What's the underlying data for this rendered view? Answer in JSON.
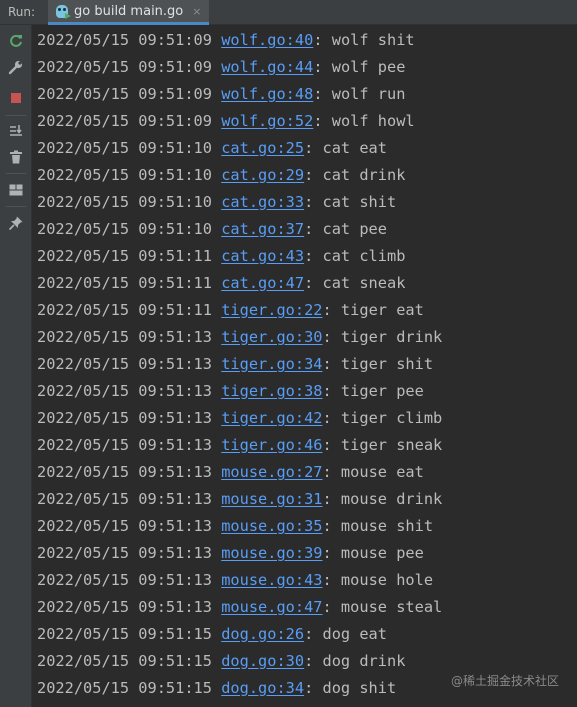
{
  "window": {
    "run_label": "Run:",
    "tab_title": "go build main.go",
    "tab_close": "×",
    "tab_icon": "go-gopher-run-icon"
  },
  "toolbar": {
    "buttons": [
      {
        "icon": "rerun-icon",
        "color": "#59a869"
      },
      {
        "icon": "wrench-icon",
        "color": "#afb1b3"
      },
      {
        "icon": "stop-icon",
        "color": "#c75450"
      },
      {
        "icon": "scroll-to-end-icon",
        "color": "#afb1b3"
      },
      {
        "icon": "trash-icon",
        "color": "#afb1b3"
      },
      {
        "icon": "layout-icon",
        "color": "#afb1b3"
      },
      {
        "icon": "pin-icon",
        "color": "#afb1b3"
      }
    ]
  },
  "console": {
    "lines": [
      {
        "timestamp": "2022/05/15 09:51:09",
        "link": "wolf.go:40",
        "message": ": wolf shit"
      },
      {
        "timestamp": "2022/05/15 09:51:09",
        "link": "wolf.go:44",
        "message": ": wolf pee"
      },
      {
        "timestamp": "2022/05/15 09:51:09",
        "link": "wolf.go:48",
        "message": ": wolf run"
      },
      {
        "timestamp": "2022/05/15 09:51:09",
        "link": "wolf.go:52",
        "message": ": wolf howl"
      },
      {
        "timestamp": "2022/05/15 09:51:10",
        "link": "cat.go:25",
        "message": ": cat eat"
      },
      {
        "timestamp": "2022/05/15 09:51:10",
        "link": "cat.go:29",
        "message": ": cat drink"
      },
      {
        "timestamp": "2022/05/15 09:51:10",
        "link": "cat.go:33",
        "message": ": cat shit"
      },
      {
        "timestamp": "2022/05/15 09:51:10",
        "link": "cat.go:37",
        "message": ": cat pee"
      },
      {
        "timestamp": "2022/05/15 09:51:11",
        "link": "cat.go:43",
        "message": ": cat climb"
      },
      {
        "timestamp": "2022/05/15 09:51:11",
        "link": "cat.go:47",
        "message": ": cat sneak"
      },
      {
        "timestamp": "2022/05/15 09:51:11",
        "link": "tiger.go:22",
        "message": ": tiger eat"
      },
      {
        "timestamp": "2022/05/15 09:51:13",
        "link": "tiger.go:30",
        "message": ": tiger drink"
      },
      {
        "timestamp": "2022/05/15 09:51:13",
        "link": "tiger.go:34",
        "message": ": tiger shit"
      },
      {
        "timestamp": "2022/05/15 09:51:13",
        "link": "tiger.go:38",
        "message": ": tiger pee"
      },
      {
        "timestamp": "2022/05/15 09:51:13",
        "link": "tiger.go:42",
        "message": ": tiger climb"
      },
      {
        "timestamp": "2022/05/15 09:51:13",
        "link": "tiger.go:46",
        "message": ": tiger sneak"
      },
      {
        "timestamp": "2022/05/15 09:51:13",
        "link": "mouse.go:27",
        "message": ": mouse eat"
      },
      {
        "timestamp": "2022/05/15 09:51:13",
        "link": "mouse.go:31",
        "message": ": mouse drink"
      },
      {
        "timestamp": "2022/05/15 09:51:13",
        "link": "mouse.go:35",
        "message": ": mouse shit"
      },
      {
        "timestamp": "2022/05/15 09:51:13",
        "link": "mouse.go:39",
        "message": ": mouse pee"
      },
      {
        "timestamp": "2022/05/15 09:51:13",
        "link": "mouse.go:43",
        "message": ": mouse hole"
      },
      {
        "timestamp": "2022/05/15 09:51:13",
        "link": "mouse.go:47",
        "message": ": mouse steal"
      },
      {
        "timestamp": "2022/05/15 09:51:15",
        "link": "dog.go:26",
        "message": ": dog eat"
      },
      {
        "timestamp": "2022/05/15 09:51:15",
        "link": "dog.go:30",
        "message": ": dog drink"
      },
      {
        "timestamp": "2022/05/15 09:51:15",
        "link": "dog.go:34",
        "message": ": dog shit"
      }
    ]
  },
  "watermark": "@稀土掘金技术社区",
  "colors": {
    "background": "#2b2b2b",
    "text": "#bbbbbb",
    "link": "#589df6",
    "toolbar": "#3c3f41",
    "tab_active": "#4e5254",
    "tab_underline": "#4a88c7"
  }
}
